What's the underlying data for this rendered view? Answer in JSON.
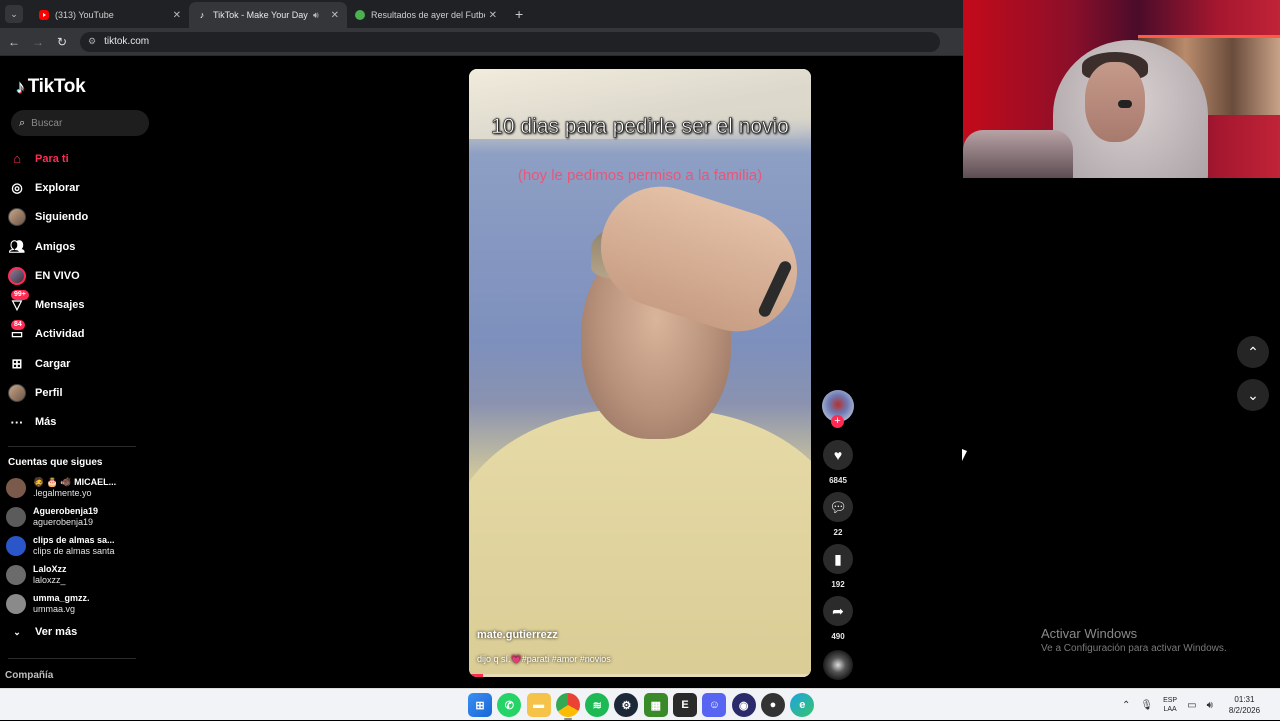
{
  "browser": {
    "tabs": [
      {
        "label": "(313) YouTube",
        "icon": "youtube-icon"
      },
      {
        "label": "TikTok - Make Your Day",
        "icon": "tiktok-icon",
        "active": true
      },
      {
        "label": "Resultados de ayer del Futbol A",
        "icon": "site-icon"
      }
    ],
    "url": "tiktok.com"
  },
  "sidebar": {
    "logo": "TikTok",
    "search_placeholder": "Buscar",
    "menu": [
      {
        "label": "Para ti",
        "icon": "home-icon",
        "active": true
      },
      {
        "label": "Explorar",
        "icon": "compass-icon"
      },
      {
        "label": "Siguiendo",
        "icon": "avatar-icon"
      },
      {
        "label": "Amigos",
        "icon": "friends-icon"
      },
      {
        "label": "EN VIVO",
        "icon": "live-icon"
      },
      {
        "label": "Mensajes",
        "icon": "messages-icon",
        "badge": "99+"
      },
      {
        "label": "Actividad",
        "icon": "activity-icon",
        "badge": "84"
      },
      {
        "label": "Cargar",
        "icon": "upload-icon"
      },
      {
        "label": "Perfil",
        "icon": "profile-icon"
      },
      {
        "label": "Más",
        "icon": "more-icon"
      }
    ],
    "following_title": "Cuentas que sigues",
    "accounts": [
      {
        "name": "🧔 🎂 🐗 MICAEL...",
        "handle": ".legalmente.yo",
        "color": "#7a5a4a"
      },
      {
        "name": "Aguerobenja19",
        "handle": "aguerobenja19",
        "color": "#5b5b5b"
      },
      {
        "name": "clips de almas sa...",
        "handle": "clips de almas santa",
        "color": "#2b56c9"
      },
      {
        "name": "LaloXzz",
        "handle": "laloxzz_",
        "color": "#6b6b6b"
      },
      {
        "name": "umma_gmzz.",
        "handle": "ummaa.vg",
        "color": "#8a8a8a"
      }
    ],
    "see_more": "Ver más",
    "company": "Compañía"
  },
  "video": {
    "title_overlay": "10 dias para pedirle ser el novio",
    "subtitle_overlay": "(hoy le pedimos permiso a la familia)",
    "username": "mate.gutierrezz",
    "description_prefix": "dijo q sí.",
    "description_heart": "💗",
    "description_tags": "#parati #amor #novios",
    "progress": 0.04
  },
  "actions": {
    "likes": "6845",
    "comments": "22",
    "saves": "192",
    "shares": "490"
  },
  "watermark": {
    "line1": "Activar Windows",
    "line2": "Ve a Configuración para activar Windows."
  },
  "taskbar": {
    "language": "ESP",
    "layout": "LAA",
    "time": "01:31",
    "date": "8/2/2026"
  },
  "colors": {
    "accent": "#fe2c55",
    "background": "#000000",
    "taskbar": "#f1f3f7"
  }
}
